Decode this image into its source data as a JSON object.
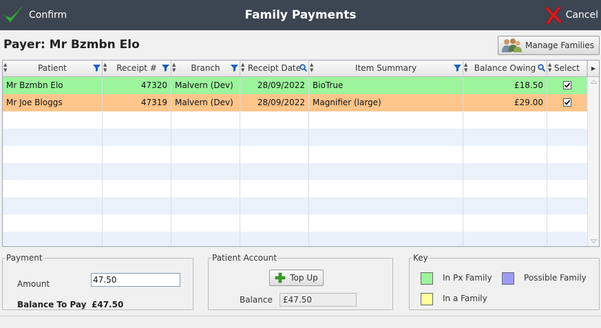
{
  "toolbar": {
    "confirm_label": "Confirm",
    "title": "Family Payments",
    "cancel_label": "Cancel"
  },
  "payer": {
    "label": "Payer: Mr Bzmbn Elo"
  },
  "manage_families_label": "Manage Families",
  "grid": {
    "columns": [
      "Patient",
      "Receipt #",
      "Branch",
      "Receipt Date",
      "Item Summary",
      "Balance Owing",
      "Select"
    ],
    "rows": [
      {
        "patient": "Mr Bzmbn Elo",
        "receipt": "47320",
        "branch": "Malvern (Dev)",
        "date": "28/09/2022",
        "item": "BioTrue",
        "balance": "£18.50",
        "selected": true,
        "status": "in_px_family",
        "color": "#9cf59c"
      },
      {
        "patient": "Mr Joe Bloggs",
        "receipt": "47319",
        "branch": "Malvern (Dev)",
        "date": "28/09/2022",
        "item": "Magnifier (large)",
        "balance": "£29.00",
        "selected": true,
        "status": "highlighted",
        "color": "#ffc58b"
      }
    ]
  },
  "payment": {
    "legend": "Payment",
    "amount_label": "Amount",
    "amount_value": "47.50",
    "balance_to_pay_label": "Balance To Pay",
    "balance_to_pay_value": "£47.50"
  },
  "patient_account": {
    "legend": "Patient Account",
    "top_up_label": "Top Up",
    "balance_label": "Balance",
    "balance_value": "£47.50"
  },
  "key": {
    "legend": "Key",
    "items": [
      {
        "label": "In Px Family",
        "color": "#9cf59c"
      },
      {
        "label": "Possible Family",
        "color": "#9c9cf5"
      },
      {
        "label": "In a Family",
        "color": "#ffff9c"
      }
    ]
  },
  "colors": {
    "titlebar": "#3d4452",
    "row_alt": "#eaf1fa",
    "confirm_check": "#3cb043",
    "cancel_cross": "#d42020"
  },
  "icons": [
    "confirm-check-icon",
    "cancel-cross-icon",
    "people-icon",
    "filter-icon",
    "search-icon",
    "plus-icon"
  ]
}
